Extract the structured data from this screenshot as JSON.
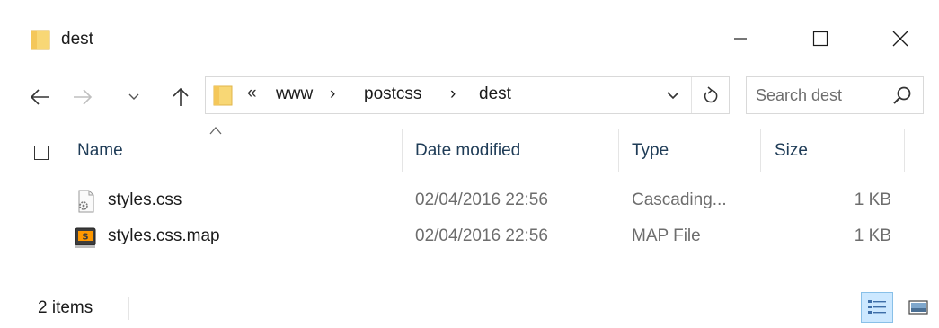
{
  "window": {
    "title": "dest",
    "controls": {
      "minimize": "minimize-icon",
      "maximize": "maximize-icon",
      "close": "close-icon"
    }
  },
  "nav": {
    "back_icon": "arrow-left-icon",
    "forward_icon": "arrow-right-icon",
    "recent_icon": "chevron-down-icon",
    "up_icon": "arrow-up-icon"
  },
  "address": {
    "overflow": "«",
    "crumbs": [
      "www",
      "postcss",
      "dest"
    ],
    "separator": "›",
    "dropdown_icon": "chevron-down-icon",
    "refresh_icon": "refresh-icon"
  },
  "search": {
    "placeholder": "Search dest",
    "value": "",
    "icon": "search-icon"
  },
  "columns": {
    "name": "Name",
    "date_modified": "Date modified",
    "type": "Type",
    "size": "Size",
    "sort": "ascending"
  },
  "files": [
    {
      "name": "styles.css",
      "date_modified": "02/04/2016 22:56",
      "type": "Cascading...",
      "size": "1 KB",
      "icon": "css-file-icon"
    },
    {
      "name": "styles.css.map",
      "date_modified": "02/04/2016 22:56",
      "type": "MAP File",
      "size": "1 KB",
      "icon": "sublime-file-icon"
    }
  ],
  "status": {
    "item_count": "2 items",
    "active_view": "details"
  },
  "colors": {
    "folder": "#f8d775",
    "accent": "#cce8ff",
    "header_text": "#1f3c57"
  }
}
